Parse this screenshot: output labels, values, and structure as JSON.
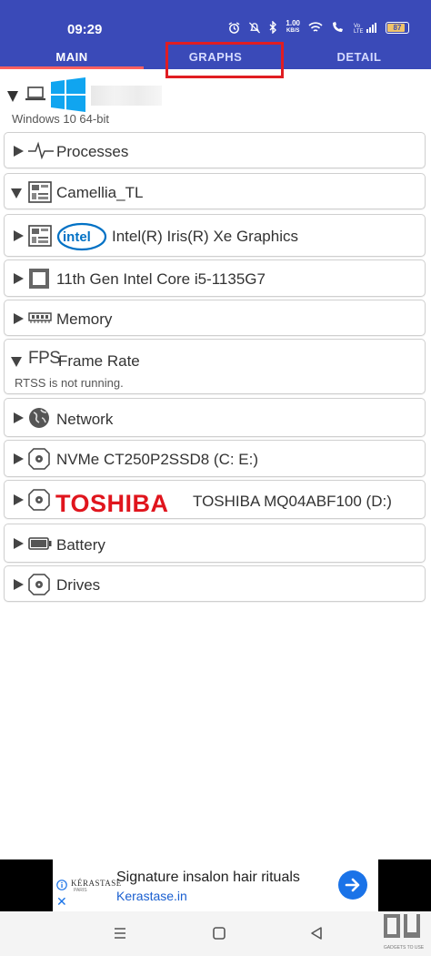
{
  "status_bar": {
    "time": "09:29",
    "net_speed_value": "1.00",
    "net_speed_unit": "KB/S",
    "battery": "87",
    "icons": [
      "alarm-icon",
      "mute-icon",
      "bluetooth-icon",
      "wifi-icon",
      "volte-icon",
      "signal-icon",
      "battery-icon"
    ]
  },
  "tabs": [
    {
      "label": "MAIN",
      "active": true
    },
    {
      "label": "GRAPHS",
      "active": false
    },
    {
      "label": "DETAIL",
      "active": false
    }
  ],
  "computer": {
    "os": "Windows 10 64-bit",
    "icons": [
      "laptop-icon",
      "windows-logo-icon"
    ]
  },
  "items": [
    {
      "label": "Processes",
      "icon": "pulse-icon"
    },
    {
      "label": "Camellia_TL",
      "icon": "motherboard-icon"
    },
    {
      "label": "Intel(R) Iris(R) Xe Graphics",
      "logo": "intel",
      "icon": "motherboard-icon"
    },
    {
      "label": "11th Gen Intel Core i5-1135G7",
      "icon": "cpu-icon"
    },
    {
      "label": "Memory",
      "icon": "ram-icon"
    },
    {
      "label": "Frame Rate",
      "icon_text": "FPS",
      "sub": "RTSS is not running."
    },
    {
      "label": "Network",
      "icon": "globe-icon"
    },
    {
      "label": "NVMe CT250P2SSD8 (C: E:)",
      "icon": "disk-icon"
    },
    {
      "label": "TOSHIBA MQ04ABF100 (D:)",
      "logo": "TOSHIBA",
      "icon": "disk-icon"
    },
    {
      "label": "Battery",
      "icon": "battery-icon"
    },
    {
      "label": "Drives",
      "icon": "disk-icon"
    }
  ],
  "ad": {
    "brand": "KÉRASTASE",
    "brand_sub": "PARIS",
    "headline": "Signature insalon hair rituals",
    "url": "Kerastase.in"
  },
  "watermark": "GADGETS TO USE",
  "colors": {
    "header": "#3a4ab8",
    "tab_indicator": "#ff6060",
    "highlight": "#e01d22",
    "toshiba_red": "#e0151d",
    "intel_blue": "#0071c5",
    "ad_link": "#1a73e8"
  }
}
